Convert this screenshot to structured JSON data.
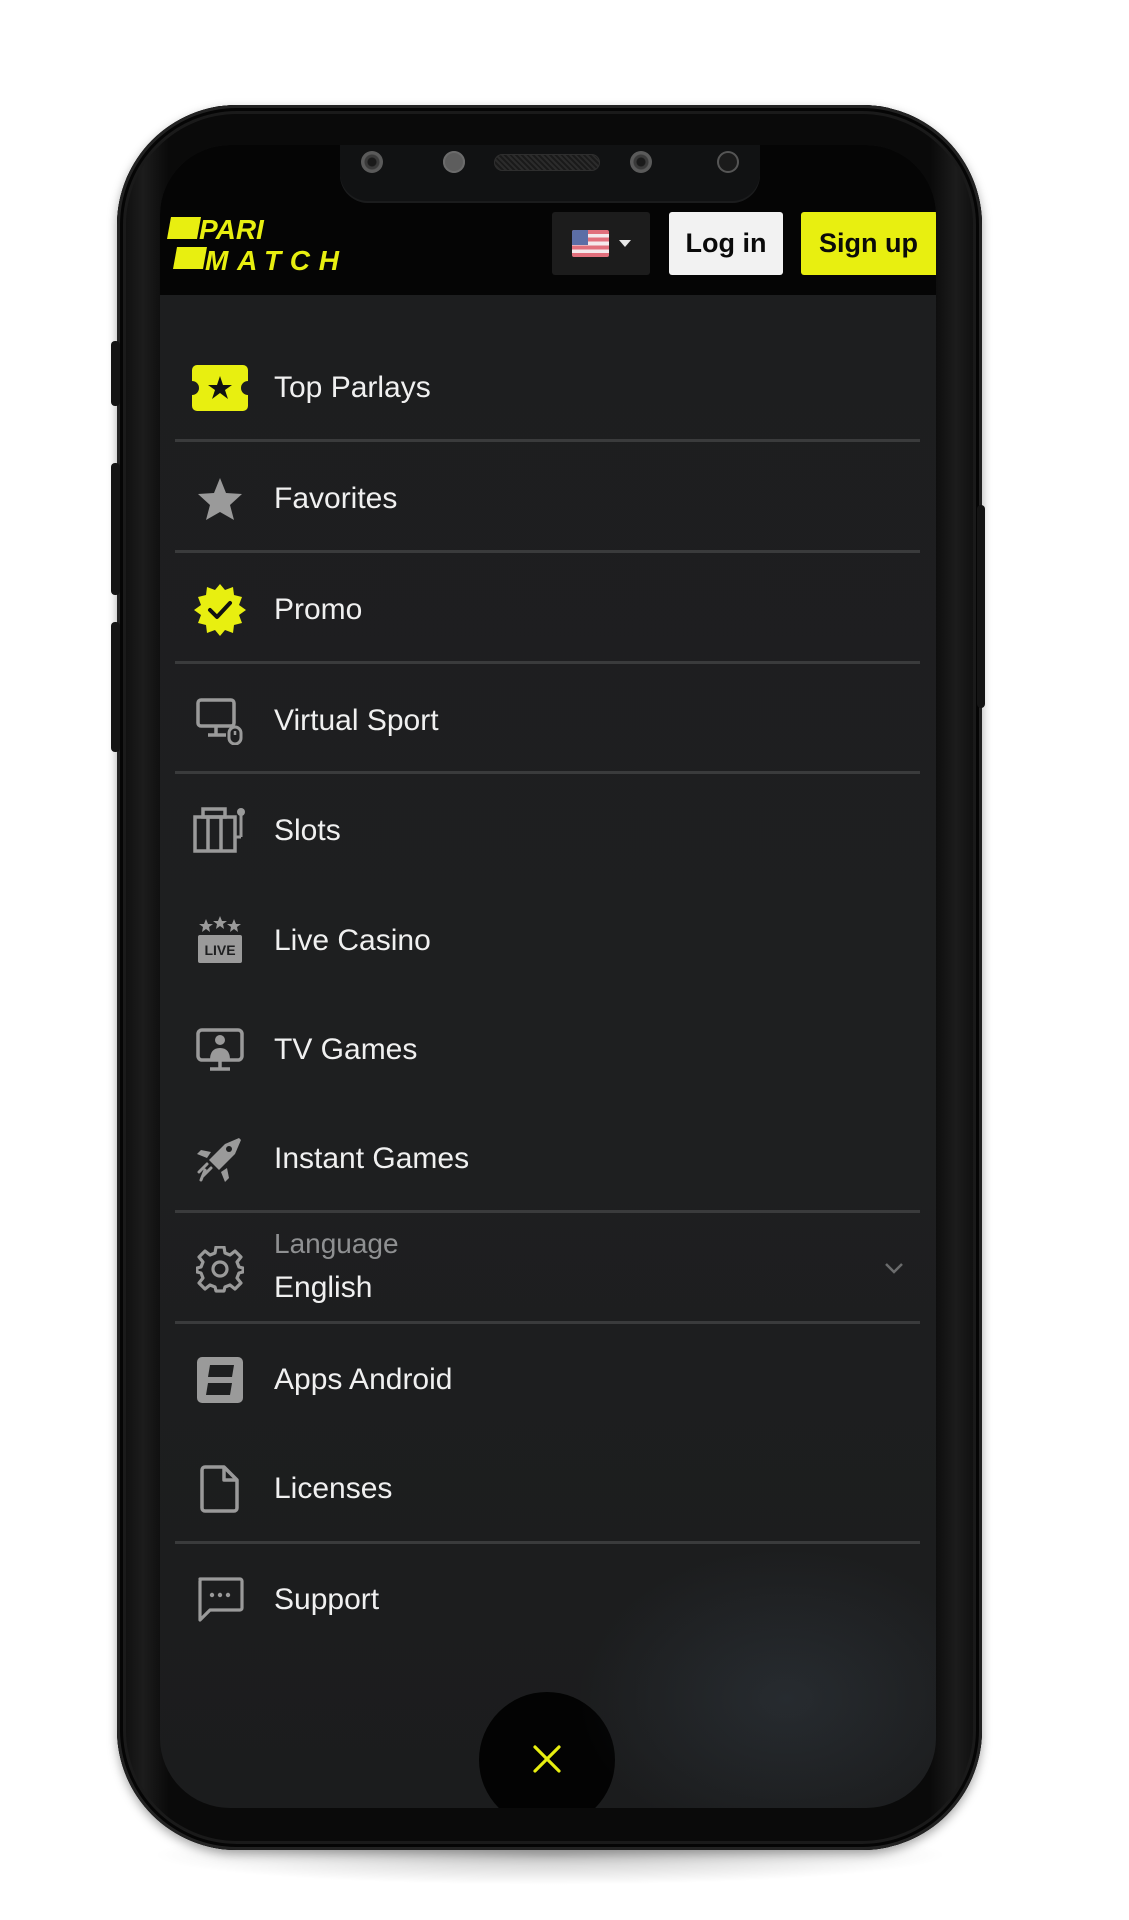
{
  "header": {
    "brand": {
      "line1": "PARI",
      "line2": "MATCH"
    },
    "language_flag_icon": "us-flag-icon",
    "login_label": "Log in",
    "signup_label": "Sign up"
  },
  "colors": {
    "accent": "#e8ef10",
    "background": "#1e1f20",
    "header_bg": "#050505",
    "text": "#f0f0f0",
    "muted_text": "#8f9092",
    "icon_gray": "#9a9a9a"
  },
  "menu": {
    "items": [
      {
        "label": "Top Parlays",
        "icon": "ticket-star-icon"
      },
      {
        "label": "Favorites",
        "icon": "star-icon"
      },
      {
        "label": "Promo",
        "icon": "badge-check-icon"
      },
      {
        "label": "Virtual Sport",
        "icon": "monitor-mouse-icon"
      },
      {
        "label": "Slots",
        "icon": "slot-machine-icon"
      },
      {
        "label": "Live Casino",
        "icon": "live-casino-icon",
        "badge": "LIVE"
      },
      {
        "label": "TV Games",
        "icon": "tv-presenter-icon"
      },
      {
        "label": "Instant Games",
        "icon": "rocket-plane-icon"
      },
      {
        "label": "Apps Android",
        "icon": "app-logo-icon"
      },
      {
        "label": "Licenses",
        "icon": "document-icon"
      },
      {
        "label": "Support",
        "icon": "chat-bubble-icon"
      }
    ],
    "language": {
      "label": "Language",
      "value": "English",
      "icon": "gear-icon"
    }
  },
  "close_button": {
    "icon": "close-icon"
  }
}
